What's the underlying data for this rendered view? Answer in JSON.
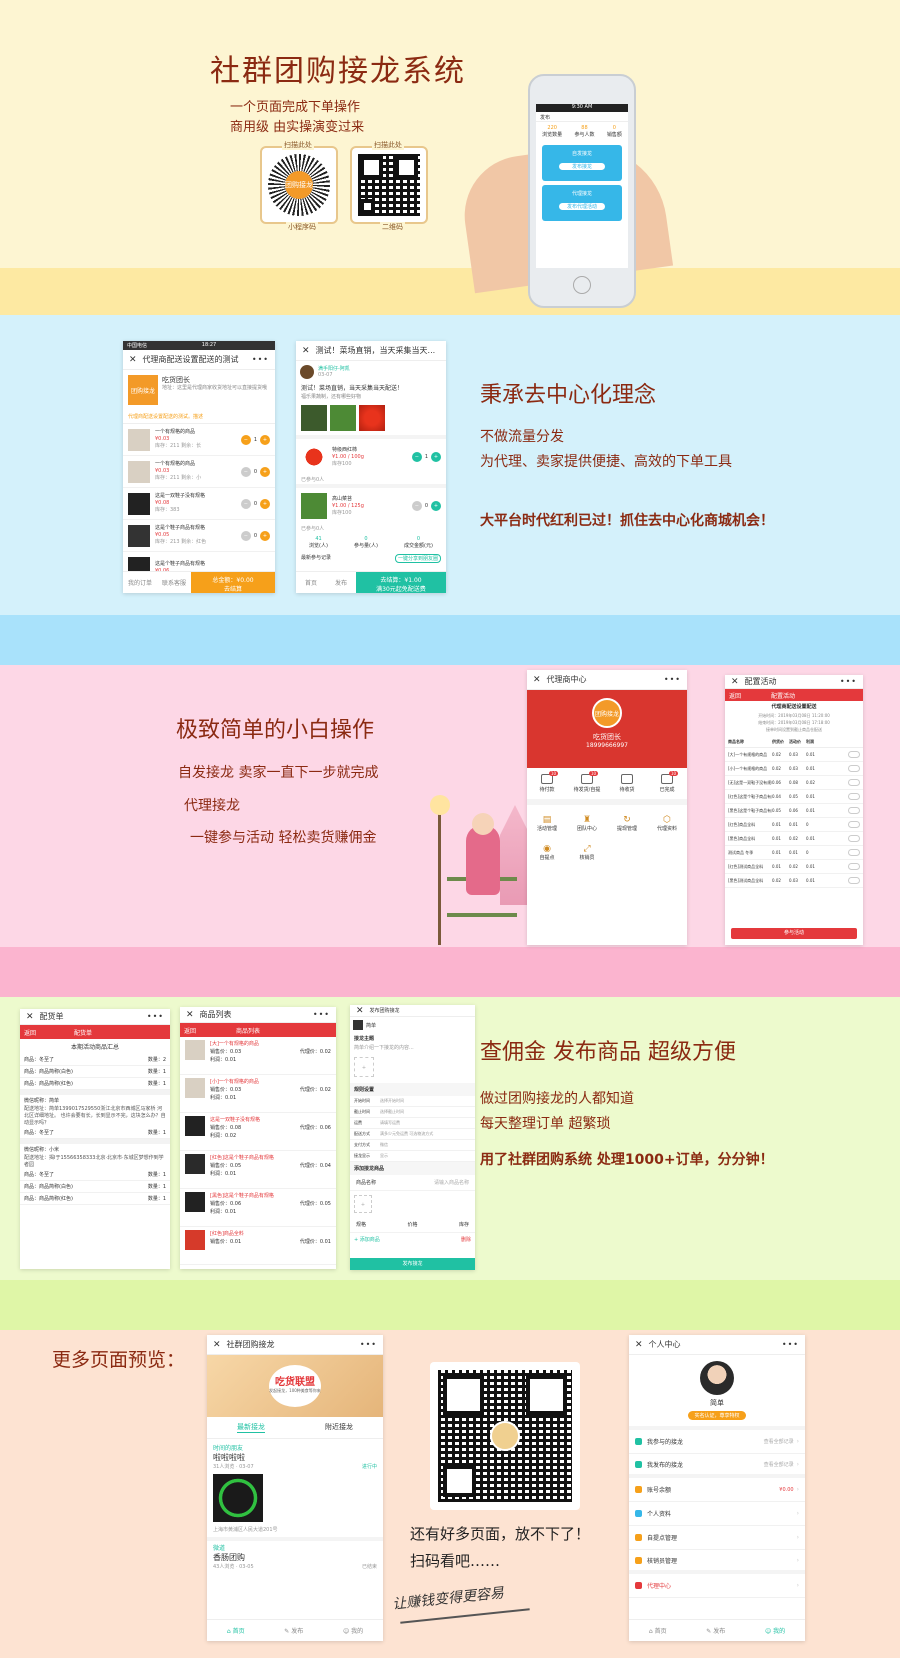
{
  "colors": {
    "s1": "#fdf5d2",
    "s1band": "#fde9a2",
    "s2": "#d4f1fb",
    "s2band": "#a9e2fb",
    "s3": "#fdd7e6",
    "s3band": "#fbb4cf",
    "s4": "#edfacd",
    "s4band": "#dff6a7",
    "s5": "#fde3d2",
    "accent": "#e4393c",
    "brown": "#8b2a12",
    "teal": "#20c1a3",
    "orange": "#f6a01a",
    "blue": "#36b7e8"
  },
  "hero": {
    "title": "社群团购接龙系统",
    "line1": "一个页面完成下单操作",
    "line2": "商用级  由实操演变过来",
    "qr1_caption_top": "扫描此处",
    "qr1_caption": "小程序码",
    "qr2_caption_top": "扫描此处",
    "qr2_caption": "二维码",
    "logo_text": "团购接龙",
    "phone": {
      "time": "9:30 AM",
      "title": "发布",
      "stats": [
        "220",
        "88",
        "0"
      ],
      "stat_labels": [
        "浏览数量",
        "参与人数",
        "销售额"
      ],
      "card1_title": "自发接龙",
      "card1_btn": "发布接龙",
      "card2_title": "代理接龙",
      "card2_btn": "发布代理活动"
    }
  },
  "sec2": {
    "heading": "秉承去中心化理念",
    "lines": [
      "不做流量分发",
      "为代理、卖家提供便捷、高效的下单工具",
      "大平台时代红利已过！抓住去中心化商城机会！"
    ],
    "phoneA": {
      "status_carrier": "中国电信",
      "status_time": "18:27",
      "bar_title": "代理商配送设置配送的测试",
      "shop_name": "吃货团长",
      "shop_addr": "地址：这里是代理商家收货地址可以直接提货哦",
      "logo_text": "团购接龙",
      "notice": "代理商配送设置配送的测试。描述",
      "items": [
        {
          "name": "一个有规格的商品",
          "price": "¥0.03",
          "meta": "库存：211 剩余：长",
          "qty": "1"
        },
        {
          "name": "一个有规格的商品",
          "price": "¥0.03",
          "meta": "库存：211 剩余：小",
          "qty": "0"
        },
        {
          "name": "这是一双鞋子没有规格",
          "price": "¥0.08",
          "meta": "库存：383",
          "qty": "0"
        },
        {
          "name": "这是个鞋子商品有规格",
          "price": "¥0.05",
          "meta": "库存：213 剩余：红色",
          "qty": "0"
        },
        {
          "name": "这是个鞋子商品有规格",
          "price": "¥0.06",
          "meta": "",
          "qty": ""
        }
      ],
      "tab1": "我的订单",
      "tab2": "联系客服",
      "total": "总金额：¥0.00",
      "submit": "去结算"
    },
    "phoneB": {
      "bar_title": "测试！菜场直销，当天采集当天...",
      "user": "满手阳仔-阿凯",
      "date": "03-07",
      "desc": "测试！菜场直销，当天采集当天配送！",
      "desc2": "福乐果蔬制，还有哪些好物",
      "items": [
        {
          "name": "特级西红柿",
          "price": "¥1.00 / 100g",
          "meta": "库存100",
          "qty": "1"
        },
        {
          "name": "高山菜苔",
          "price": "¥1.00 / 125g",
          "meta": "库存100",
          "qty": "0"
        }
      ],
      "subtotal1": "已参与0人",
      "subtotal2": "已参与0人",
      "stats": [
        "41",
        "0",
        "0"
      ],
      "stat_labels": [
        "浏览(人)",
        "参与量(人)",
        "成交金额(元)"
      ],
      "recent": "最新参与记录",
      "share": "一键分享到朋友圈",
      "tab1": "首页",
      "tab2": "发布",
      "total": "去结算：¥1.00",
      "total_sub": "满30元起免配送费"
    }
  },
  "sec3": {
    "heading": "极致简单的小白操作",
    "lines": [
      "自发接龙  卖家一直下一步就完成",
      "代理接龙",
      "一键参与活动  轻松卖货赚佣金"
    ],
    "phoneA": {
      "bar_title": "代理商中心",
      "name": "吃货团长",
      "phone": "18999666997",
      "logo_text": "团购接龙",
      "orders": [
        "待付款",
        "待发货/自提",
        "待收货",
        "已完成"
      ],
      "badges": [
        "10",
        "10",
        "",
        "10"
      ],
      "grid": [
        "活动管理",
        "团队中心",
        "提现管理",
        "代理资料",
        "自提点",
        "核销员"
      ]
    },
    "phoneB": {
      "bar_title": "配置活动",
      "back": "返回",
      "head": "配置活动",
      "title": "代理商配送设置配送",
      "info": [
        "开始时间：2019年03月08日 11:20:00",
        "结束时间：2019年03月08日 17:18:00",
        "接单时间设置到截止商品仓配送"
      ],
      "cols": [
        "商品名称",
        "供货价",
        "活动价",
        "利润"
      ],
      "rows": [
        [
          "[大]一个有规格的商品",
          "0.02",
          "0.03",
          "0.01"
        ],
        [
          "[小]一个有规格的商品",
          "0.02",
          "0.03",
          "0.01"
        ],
        [
          "[无]这是一双鞋子没有规格",
          "0.06",
          "0.08",
          "0.02"
        ],
        [
          "[红色]这是个鞋子商品有规格",
          "0.04",
          "0.05",
          "0.01"
        ],
        [
          "[黑色]这是个鞋子商品有规格",
          "0.05",
          "0.06",
          "0.01"
        ],
        [
          "[红色]商品全料",
          "0.01",
          "0.01",
          "0"
        ],
        [
          "[黑色]商品全料",
          "0.01",
          "0.02",
          "0.01"
        ],
        [
          "测试商品 冬季",
          "0.01",
          "0.01",
          "0"
        ],
        [
          "[红色]测试商品全料",
          "0.01",
          "0.02",
          "0.01"
        ],
        [
          "[黑色]测试商品全料",
          "0.02",
          "0.03",
          "0.01"
        ]
      ],
      "btn": "参与活动"
    }
  },
  "sec4": {
    "heading": "查佣金  发布商品  超级方便",
    "lines": [
      "做过团购接龙的人都知道",
      "每天整理订单  超繁琐",
      "用了社群团购系统  处理1000+订单，分分钟！"
    ],
    "phoneA": {
      "bar_title": "配货单",
      "back": "返回",
      "head": "配货单",
      "summary": "本期活动商品汇总",
      "rows": [
        [
          "商品：冬至了",
          "数量：2"
        ],
        [
          "商品：商品简称(白色)",
          "数量：1"
        ],
        [
          "商品：商品简称(红色)",
          "数量：1"
        ]
      ],
      "buyer1": "微信昵称：简单",
      "addr1": "配送地址：简单1399017529550浙江北京市西城区马家桥 河北区详细地址。 也许会要有长，长到显示不完，这块怎么办？自动显示吗？",
      "rows2": [
        [
          "商品：冬至了",
          "数量：1"
        ]
      ],
      "buyer2": "微信昵称：小米",
      "addr2": "配送地址：揭I于15566358333北京·北京市·东城区梦想作到学者园",
      "rows3": [
        [
          "商品：冬至了",
          "数量：1"
        ],
        [
          "商品：商品简称(白色)",
          "数量：1"
        ],
        [
          "商品：商品简称(红色)",
          "数量：1"
        ]
      ]
    },
    "phoneB": {
      "bar_title": "商品列表",
      "back": "返回",
      "head": "商品列表",
      "items": [
        {
          "name": "[大]一个有规格的商品",
          "a": "销售价：0.03",
          "b": "代理价：0.02",
          "c": "利润：0.01"
        },
        {
          "name": "[小]一个有规格的商品",
          "a": "销售价：0.03",
          "b": "代理价：0.02",
          "c": "利润：0.01"
        },
        {
          "name": "这是一双鞋子没有规格",
          "a": "销售价：0.08",
          "b": "代理价：0.06",
          "c": "利润：0.02"
        },
        {
          "name": "[红色]这是个鞋子商品有规格",
          "a": "销售价：0.05",
          "b": "代理价：0.04",
          "c": "利润：0.01"
        },
        {
          "name": "[黑色]这是个鞋子商品有规格",
          "a": "销售价：0.06",
          "b": "代理价：0.05",
          "c": "利润：0.01"
        },
        {
          "name": "[红色]商品全料",
          "a": "销售价：0.01",
          "b": "代理价：0.01",
          "c": ""
        }
      ]
    },
    "phoneC": {
      "bar_title": "发布团购接龙",
      "user": "简单",
      "f1": "接龙主题",
      "f2": "简单介绍一下接龙的内容...",
      "s1": "规则设置",
      "rules": [
        [
          "开始时间",
          "选择开始时间"
        ],
        [
          "截止时间",
          "选择截止时间"
        ],
        [
          "运费",
          "请填写运费"
        ],
        [
          "配送方式",
          "满多少元免运费 可选物流方式"
        ],
        [
          "支付方式",
          "微信"
        ],
        [
          "接龙显示",
          "显示"
        ]
      ],
      "s2": "添加接龙商品",
      "g1": "商品名称",
      "g2": "请输入商品名称",
      "g3": "规格",
      "g4": "价格",
      "g5": "库存",
      "add": "+ 添加商品",
      "del": "删除",
      "btn": "发布接龙"
    }
  },
  "sec5": {
    "heading": "更多页面预览：",
    "cta1": "还有好多页面，放不下了！",
    "cta2": "扫码看吧……",
    "slogan": "让赚钱变得更容易",
    "phoneA": {
      "bar_title": "社群团购接龙",
      "banner": "吃货联盟",
      "banner_sub": "发起接龙，100种美食等你来",
      "tab1": "最新接龙",
      "tab2": "附近接龙",
      "post1_user": "时间的朋友",
      "post1_title": "啦啦啦啦",
      "post1_meta": "31人浏览 · 03-07",
      "post1_status": "进行中",
      "post1_addr": "上海市黄浦区人民大道201号",
      "post2_user": "微道",
      "post2_title": "香肠团购",
      "post2_meta": "43人浏览 · 03-05",
      "post2_status": "已结束",
      "tabs": [
        "首页",
        "发布",
        "我的"
      ]
    },
    "phoneB": {
      "bar_title": "个人中心",
      "name": "简单",
      "badge": "实名认证，尊享特权",
      "menu": [
        {
          "label": "我参与的接龙",
          "value": "查看全部记录"
        },
        {
          "label": "我发布的接龙",
          "value": "查看全部记录"
        },
        {
          "label": "账号余额",
          "value": "¥0.00"
        },
        {
          "label": "个人资料",
          "value": ""
        },
        {
          "label": "自提点管理",
          "value": ""
        },
        {
          "label": "核销员管理",
          "value": ""
        },
        {
          "label": "代理中心",
          "value": ""
        }
      ],
      "tabs": [
        "首页",
        "发布",
        "我的"
      ]
    }
  }
}
